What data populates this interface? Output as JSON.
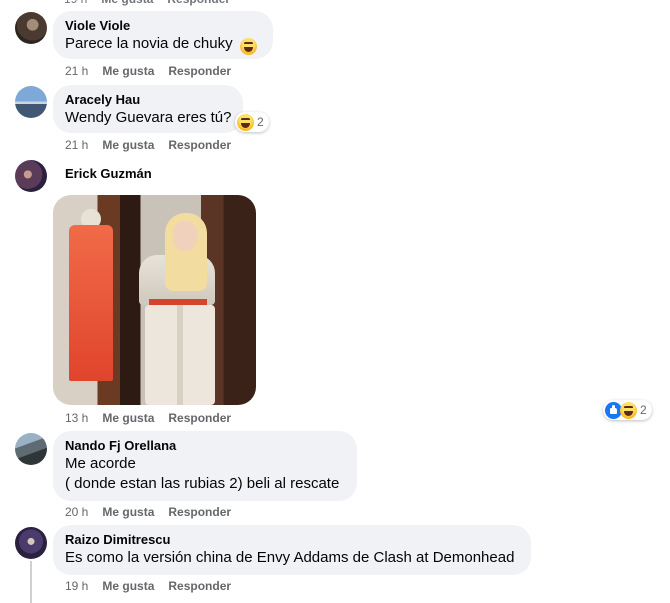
{
  "comments": [
    {
      "author": "Viole Viole",
      "text": "Parece la novia de chuky",
      "time": "21 h",
      "like_label": "Me gusta",
      "reply_label": "Responder",
      "reaction": "haha"
    },
    {
      "author": "Aracely Hau",
      "text": "Wendy Guevara eres tú?",
      "time": "21 h",
      "like_label": "Me gusta",
      "reply_label": "Responder",
      "reaction": "haha",
      "reaction_count": "2"
    },
    {
      "author": "Erick Guzmán",
      "attachment": "photo",
      "time": "13 h",
      "like_label": "Me gusta",
      "reply_label": "Responder",
      "reactions": [
        "like",
        "haha"
      ],
      "reaction_count": "2"
    },
    {
      "author": "Nando Fj Orellana",
      "text_lines": [
        "Me acorde",
        "( donde estan las rubias 2) beli al rescate"
      ],
      "time": "20 h",
      "like_label": "Me gusta",
      "reply_label": "Responder"
    },
    {
      "author": "Raizo Dimitrescu",
      "text": "Es como la versión china de Envy Addams de Clash at Demonhead",
      "time": "19 h",
      "like_label": "Me gusta",
      "reply_label": "Responder"
    }
  ],
  "colors": {
    "bubble": "#f0f2f5",
    "meta_text": "#65676b",
    "like_blue": "#1877f2",
    "haha_yellow": "#f7b928"
  }
}
